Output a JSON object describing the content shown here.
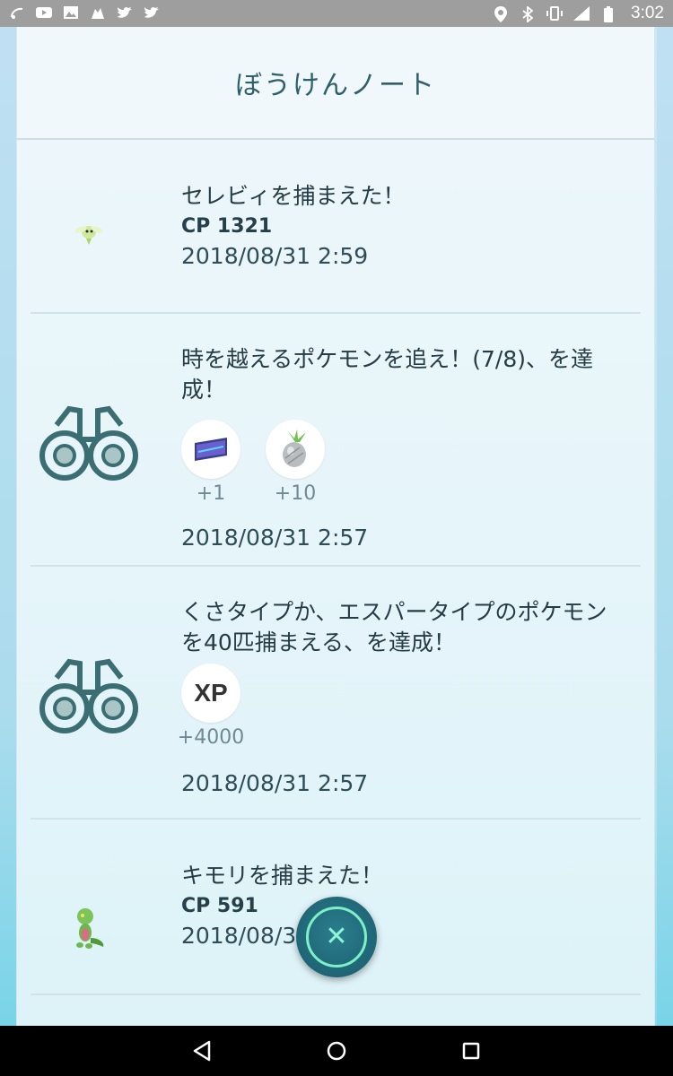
{
  "status_bar": {
    "left_icons": [
      "wifi-calling-icon",
      "youtube-icon",
      "image-icon",
      "pokeball-notification-icon",
      "twitter-icon",
      "twitter-icon"
    ],
    "right_icons": [
      "location-icon",
      "bluetooth-icon",
      "vibrate-icon",
      "signal-4g-icon",
      "battery-icon"
    ],
    "time": "3:02"
  },
  "header": {
    "title": "ぼうけんノート"
  },
  "entries": [
    {
      "icon": "celebi-icon",
      "title": "セレビィを捕まえた！",
      "cp": "CP 1321",
      "date": "2018/08/31 2:59"
    },
    {
      "icon": "binoculars-icon",
      "title": "時を越えるポケモンを追え！(7/8)、を達成！",
      "rewards": [
        {
          "icon": "map-item-icon",
          "count": "+1"
        },
        {
          "icon": "pinap-berry-icon",
          "count": "+10"
        }
      ],
      "date": "2018/08/31 2:57"
    },
    {
      "icon": "binoculars-icon",
      "title": "くさタイプか、エスパータイプのポケモンを40匹捕まえる、を達成！",
      "rewards": [
        {
          "label": "XP",
          "count": "+4000"
        }
      ],
      "date": "2018/08/31 2:57"
    },
    {
      "icon": "treecko-icon",
      "title": "キモリを捕まえた！",
      "cp": "CP 591",
      "date": "2018/08/3"
    }
  ],
  "fab": {
    "icon": "close-icon"
  },
  "nav_bar": {
    "buttons": [
      "back-icon",
      "home-icon",
      "recents-icon"
    ]
  },
  "colors": {
    "accent": "#7ef0c8",
    "text_dark": "#263c44",
    "panel_bg": "#eef7fb"
  }
}
